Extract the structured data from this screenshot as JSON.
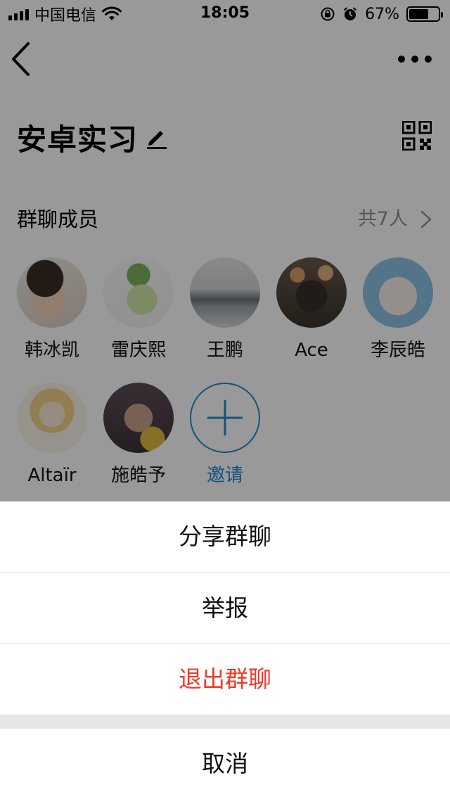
{
  "status_bar": {
    "carrier": "中国电信",
    "time": "18:05",
    "battery_percent": "67%",
    "battery_level": 0.67,
    "icons": [
      "signal-icon",
      "wifi-icon",
      "rotation-lock-icon",
      "alarm-icon",
      "battery-icon"
    ]
  },
  "nav": {
    "back_icon": "chevron-left-icon",
    "more_icon": "more-dots-icon"
  },
  "group": {
    "title": "安卓实习",
    "edit_icon": "pencil-icon",
    "qr_icon": "qr-code-icon"
  },
  "members_section": {
    "title": "群聊成员",
    "count": "共7人",
    "chevron_icon": "chevron-right-icon"
  },
  "members": [
    {
      "name": "韩冰凯",
      "avatar": "kid-photo"
    },
    {
      "name": "雷庆熙",
      "avatar": "pokemon-picture"
    },
    {
      "name": "王鹏",
      "avatar": "misty-trees-photo"
    },
    {
      "name": "Ace",
      "avatar": "wolf-flower-crown-photo"
    },
    {
      "name": "李辰皓",
      "avatar": "cartoon-hamster-picture"
    },
    {
      "name": "Altaïr",
      "avatar": "anime-girl-picture"
    },
    {
      "name": "施皓予",
      "avatar": "footballer-photo"
    }
  ],
  "invite": {
    "label": "邀请",
    "icon": "plus-icon"
  },
  "action_sheet": {
    "share": "分享群聊",
    "report": "举报",
    "leave": "退出群聊",
    "cancel": "取消"
  },
  "colors": {
    "accent": "#1f8bd3",
    "danger": "#ee3b27",
    "overlay": "rgba(0,0,0,0.4)",
    "secondary_text": "#8e8e8e",
    "sheet_gap": "#e6e6e6"
  }
}
